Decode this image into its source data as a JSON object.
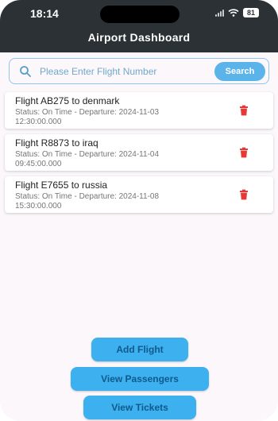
{
  "status_bar": {
    "time": "18:14",
    "battery": "81"
  },
  "header": {
    "title": "Airport Dashboard"
  },
  "search": {
    "placeholder": "Please Enter Flight Number",
    "value": "",
    "button_label": "Search"
  },
  "flights": [
    {
      "title": "Flight AB275 to denmark",
      "status": "Status: On Time - Departure: 2024-11-03",
      "time": "12:30:00.000"
    },
    {
      "title": "Flight R8873 to iraq",
      "status": "Status: On Time - Departure: 2024-11-04",
      "time": "09:45:00.000"
    },
    {
      "title": "Flight E7655 to russia",
      "status": "Status: On Time - Departure: 2024-11-08",
      "time": "15:30:00.000"
    }
  ],
  "actions": {
    "add_flight": "Add Flight",
    "view_passengers": "View Passengers",
    "view_tickets": "View Tickets"
  },
  "colors": {
    "header_bg": "#2b3134",
    "accent": "#3db0ef",
    "delete": "#e53935",
    "background": "#fbf7fb"
  }
}
